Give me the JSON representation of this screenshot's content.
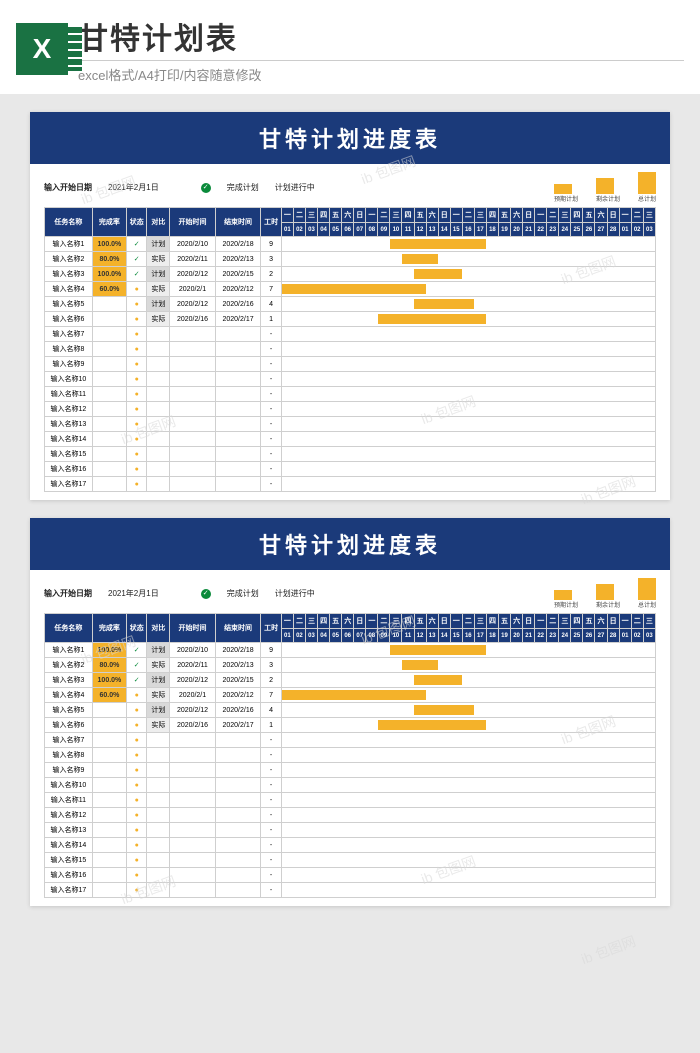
{
  "header": {
    "title": "甘特计划表",
    "subtitle": "excel格式/A4打印/内容随意修改"
  },
  "sheet": {
    "title": "甘特计划进度表",
    "meta": {
      "start_label": "输入开始日期",
      "start_value": "2021年2月1日",
      "legend_done": "完成计划",
      "legend_prog": "计划进行中",
      "mini_labels": [
        "预期计划",
        "剩余计划",
        "总计划"
      ]
    },
    "columns": [
      "任务名称",
      "完成率",
      "状态",
      "对比",
      "开始时间",
      "结束时间",
      "工时"
    ],
    "day_headers_top": [
      "一",
      "二",
      "三",
      "四",
      "五",
      "六",
      "日",
      "一",
      "二",
      "三",
      "四",
      "五",
      "六",
      "日",
      "一",
      "二",
      "三",
      "四",
      "五",
      "六",
      "日",
      "一",
      "二",
      "三",
      "四",
      "五",
      "六",
      "日",
      "一",
      "二",
      "三"
    ],
    "day_headers_num": [
      "01",
      "02",
      "03",
      "04",
      "05",
      "06",
      "07",
      "08",
      "09",
      "10",
      "11",
      "12",
      "13",
      "14",
      "15",
      "16",
      "17",
      "18",
      "19",
      "20",
      "21",
      "22",
      "23",
      "24",
      "25",
      "26",
      "27",
      "28",
      "01",
      "02",
      "03"
    ],
    "rows": [
      {
        "name": "输入名称1",
        "pct": "100.0%",
        "done": true,
        "tag": "计划",
        "start": "2020/2/10",
        "end": "2020/2/18",
        "dur": "9",
        "bar": [
          9,
          8
        ]
      },
      {
        "name": "输入名称2",
        "pct": "80.0%",
        "done": true,
        "tag": "实际",
        "start": "2020/2/11",
        "end": "2020/2/13",
        "dur": "3",
        "bar": [
          10,
          3
        ]
      },
      {
        "name": "输入名称3",
        "pct": "100.0%",
        "done": true,
        "tag": "计划",
        "start": "2020/2/12",
        "end": "2020/2/15",
        "dur": "2",
        "bar": [
          11,
          4
        ]
      },
      {
        "name": "输入名称4",
        "pct": "60.0%",
        "done": false,
        "tag": "实际",
        "start": "2020/2/1",
        "end": "2020/2/12",
        "dur": "7",
        "bar": [
          0,
          12
        ]
      },
      {
        "name": "输入名称5",
        "pct": "",
        "done": false,
        "tag": "计划",
        "start": "2020/2/12",
        "end": "2020/2/16",
        "dur": "4",
        "bar": [
          11,
          5
        ]
      },
      {
        "name": "输入名称6",
        "pct": "",
        "done": false,
        "tag": "实际",
        "start": "2020/2/16",
        "end": "2020/2/17",
        "dur": "1",
        "bar": [
          8,
          9
        ]
      },
      {
        "name": "输入名称7",
        "pct": "",
        "done": false,
        "tag": "",
        "start": "",
        "end": "",
        "dur": "-",
        "bar": null
      },
      {
        "name": "输入名称8",
        "pct": "",
        "done": false,
        "tag": "",
        "start": "",
        "end": "",
        "dur": "-",
        "bar": null
      },
      {
        "name": "输入名称9",
        "pct": "",
        "done": false,
        "tag": "",
        "start": "",
        "end": "",
        "dur": "-",
        "bar": null
      },
      {
        "name": "输入名称10",
        "pct": "",
        "done": false,
        "tag": "",
        "start": "",
        "end": "",
        "dur": "-",
        "bar": null
      },
      {
        "name": "输入名称11",
        "pct": "",
        "done": false,
        "tag": "",
        "start": "",
        "end": "",
        "dur": "-",
        "bar": null
      },
      {
        "name": "输入名称12",
        "pct": "",
        "done": false,
        "tag": "",
        "start": "",
        "end": "",
        "dur": "-",
        "bar": null
      },
      {
        "name": "输入名称13",
        "pct": "",
        "done": false,
        "tag": "",
        "start": "",
        "end": "",
        "dur": "-",
        "bar": null
      },
      {
        "name": "输入名称14",
        "pct": "",
        "done": false,
        "tag": "",
        "start": "",
        "end": "",
        "dur": "-",
        "bar": null
      },
      {
        "name": "输入名称15",
        "pct": "",
        "done": false,
        "tag": "",
        "start": "",
        "end": "",
        "dur": "-",
        "bar": null
      },
      {
        "name": "输入名称16",
        "pct": "",
        "done": false,
        "tag": "",
        "start": "",
        "end": "",
        "dur": "-",
        "bar": null
      },
      {
        "name": "输入名称17",
        "pct": "",
        "done": false,
        "tag": "",
        "start": "",
        "end": "",
        "dur": "-",
        "bar": null
      }
    ]
  },
  "watermark": "ib 包图网"
}
